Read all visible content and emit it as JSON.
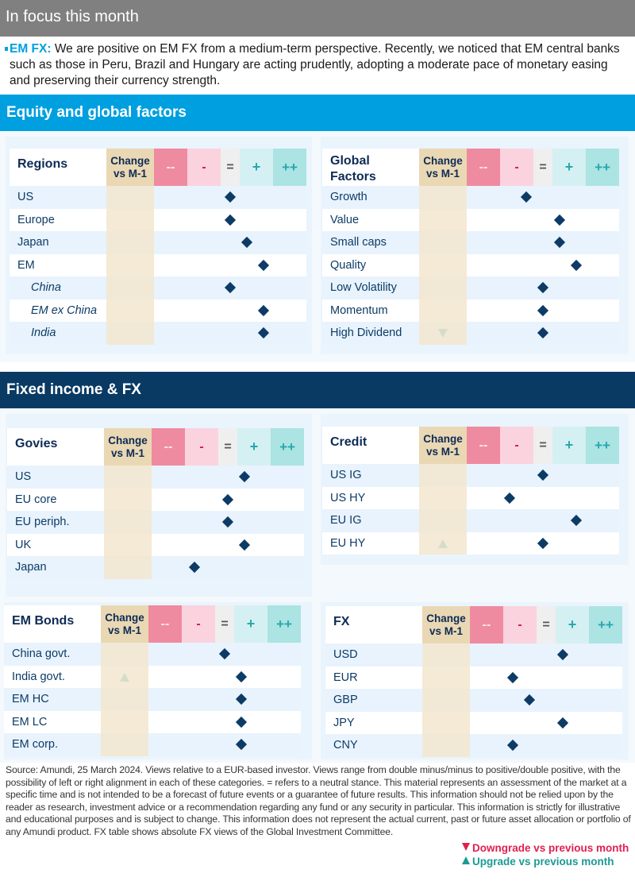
{
  "focus": {
    "title": "In focus this month",
    "label": "EM FX:",
    "text": " We are positive on EM FX from a medium-term perspective. Recently, we noticed that EM central banks such as those in Peru, Brazil and Hungary are acting prudently, adopting a moderate pace of monetary easing and preserving their currency strength."
  },
  "sections": {
    "equity": "Equity and global factors",
    "fixed_income": "Fixed income & FX"
  },
  "scale_labels": {
    "change": "Change vs M-1",
    "double_minus": "--",
    "minus": "-",
    "neutral": "=",
    "plus": "+",
    "double_plus": "++"
  },
  "tables": [
    {
      "id": "regions",
      "title": "Regions",
      "rows": [
        {
          "name": "US",
          "view": 0,
          "change": null,
          "sub": false
        },
        {
          "name": "Europe",
          "view": 0,
          "change": null,
          "sub": false
        },
        {
          "name": "Japan",
          "view": 0.5,
          "change": null,
          "sub": false
        },
        {
          "name": "EM",
          "view": 1,
          "change": null,
          "sub": false
        },
        {
          "name": "China",
          "view": 0,
          "change": null,
          "sub": true
        },
        {
          "name": "EM ex China",
          "view": 1,
          "change": null,
          "sub": true
        },
        {
          "name": "India",
          "view": 1,
          "change": null,
          "sub": true
        }
      ]
    },
    {
      "id": "global-factors",
      "title": "Global Factors",
      "rows": [
        {
          "name": "Growth",
          "view": -0.5,
          "change": null
        },
        {
          "name": "Value",
          "view": 0.5,
          "change": null
        },
        {
          "name": "Small caps",
          "view": 0.5,
          "change": null
        },
        {
          "name": "Quality",
          "view": 1,
          "change": null
        },
        {
          "name": "Low Volatility",
          "view": 0,
          "change": null
        },
        {
          "name": "Momentum",
          "view": 0,
          "change": null
        },
        {
          "name": "High Dividend",
          "view": 0,
          "change": "down"
        }
      ]
    },
    {
      "id": "govies",
      "title": "Govies",
      "rows": [
        {
          "name": "US",
          "view": 0.5,
          "change": null
        },
        {
          "name": "EU core",
          "view": 0,
          "change": null
        },
        {
          "name": "EU periph.",
          "view": 0,
          "change": null
        },
        {
          "name": "UK",
          "view": 0.5,
          "change": null
        },
        {
          "name": "Japan",
          "view": -1,
          "change": null
        }
      ]
    },
    {
      "id": "credit",
      "title": "Credit",
      "rows": [
        {
          "name": "US IG",
          "view": 0,
          "change": null
        },
        {
          "name": "US HY",
          "view": -1,
          "change": null
        },
        {
          "name": "EU IG",
          "view": 1,
          "change": null
        },
        {
          "name": "EU HY",
          "view": 0,
          "change": "up"
        }
      ]
    },
    {
      "id": "em-bonds",
      "title": "EM Bonds",
      "rows": [
        {
          "name": "China govt.",
          "view": 0,
          "change": null
        },
        {
          "name": "India govt.",
          "view": 0.5,
          "change": "up"
        },
        {
          "name": "EM HC",
          "view": 0.5,
          "change": null
        },
        {
          "name": "EM LC",
          "view": 0.5,
          "change": null
        },
        {
          "name": "EM corp.",
          "view": 0.5,
          "change": null
        }
      ]
    },
    {
      "id": "fx",
      "title": "FX",
      "rows": [
        {
          "name": "USD",
          "view": 0.5,
          "change": null
        },
        {
          "name": "EUR",
          "view": -1,
          "change": null
        },
        {
          "name": "GBP",
          "view": -0.5,
          "change": null
        },
        {
          "name": "JPY",
          "view": 0.5,
          "change": null
        },
        {
          "name": "CNY",
          "view": -1,
          "change": null
        }
      ]
    }
  ],
  "footer": {
    "source": "Source: Amundi, 25 March 2024. Views relative to a EUR-based investor. Views range from double minus/minus to positive/double positive, with the possibility of left or right alignment in each of these categories. = refers to a neutral stance. This material represents an assessment of the market at a specific time and is not intended to be a forecast of future events or a guarantee of future results. This information should not be relied upon by the reader as research, investment advice or a recommendation regarding any fund or any security in particular. This information is strictly for illustrative and educational purposes and is subject to change. This information does not represent the actual current, past or future asset allocation or portfolio of any Amundi product. FX table shows absolute FX views of the Global Investment Committee.",
    "legend_down": "Downgrade vs previous month",
    "legend_up": "Upgrade vs previous month"
  },
  "colors": {
    "equity_header": "#00a0e0",
    "fixed_income_header": "#083a64",
    "focus_header": "#808080",
    "downgrade": "#e0204f",
    "upgrade": "#1b9a94",
    "diamond": "#0d3b66"
  }
}
